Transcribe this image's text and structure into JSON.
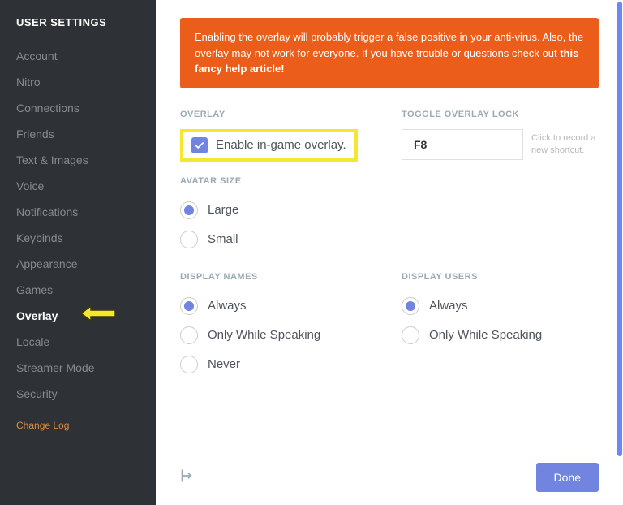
{
  "sidebar": {
    "title": "USER SETTINGS",
    "items": [
      {
        "label": "Account"
      },
      {
        "label": "Nitro"
      },
      {
        "label": "Connections"
      },
      {
        "label": "Friends"
      },
      {
        "label": "Text & Images"
      },
      {
        "label": "Voice"
      },
      {
        "label": "Notifications"
      },
      {
        "label": "Keybinds"
      },
      {
        "label": "Appearance"
      },
      {
        "label": "Games"
      },
      {
        "label": "Overlay"
      },
      {
        "label": "Locale"
      },
      {
        "label": "Streamer Mode"
      },
      {
        "label": "Security"
      }
    ],
    "changelog": "Change Log"
  },
  "banner": {
    "text1": "Enabling the overlay will probably trigger a false positive in your anti-virus. Also, the overlay may not work for everyone. If you have trouble or questions check out ",
    "link": "this fancy help article!"
  },
  "overlay_section": {
    "label": "OVERLAY",
    "checkbox_text": "Enable in-game overlay."
  },
  "toggle_section": {
    "label": "TOGGLE OVERLAY LOCK",
    "shortcut_value": "F8",
    "hint": "Click to record a new shortcut."
  },
  "avatar_section": {
    "label": "AVATAR SIZE",
    "options": [
      "Large",
      "Small"
    ]
  },
  "display_names": {
    "label": "DISPLAY NAMES",
    "options": [
      "Always",
      "Only While Speaking",
      "Never"
    ]
  },
  "display_users": {
    "label": "DISPLAY USERS",
    "options": [
      "Always",
      "Only While Speaking"
    ]
  },
  "footer": {
    "done": "Done"
  }
}
